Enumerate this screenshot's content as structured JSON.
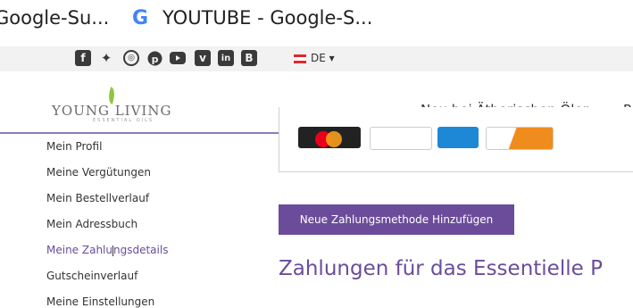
{
  "browser": {
    "tabs": [
      {
        "title": "Google-Su..."
      },
      {
        "title": "YOUTUBE - Google-S..."
      }
    ],
    "google_icon_glyph": "G"
  },
  "social": {
    "icons": [
      "facebook-icon",
      "twitter-icon",
      "instagram-icon",
      "pinterest-icon",
      "youtube-icon",
      "vimeo-icon",
      "linkedin-icon",
      "blog-icon"
    ],
    "language": "DE ▾"
  },
  "header": {
    "logo_text": "YOUNG LIVING",
    "logo_sub": "ESSENTIAL OILS",
    "nav": [
      "Neu bei Ätherischen Ölen",
      "P"
    ]
  },
  "sidebar": {
    "items": [
      {
        "label": "Mein Profil",
        "active": false
      },
      {
        "label": "Meine Vergütungen",
        "active": false
      },
      {
        "label": "Mein Bestellverlauf",
        "active": false
      },
      {
        "label": "Mein Adressbuch",
        "active": false
      },
      {
        "label_before": "Meine Zahlu",
        "label_after": "ngsdetails",
        "active": true
      },
      {
        "label": "Gutscheinverlauf",
        "active": false
      },
      {
        "label": "Meine Einstellungen",
        "active": false
      }
    ]
  },
  "main": {
    "add_button": "Neue Zahlungsmethode Hinzufügen",
    "heading": "Zahlungen für das Essentielle P"
  },
  "colors": {
    "accent": "#6b4c9a",
    "header_border": "#8e7cb7",
    "logo_leaf": "#8cc63f",
    "flag_red": "#e3262b"
  }
}
